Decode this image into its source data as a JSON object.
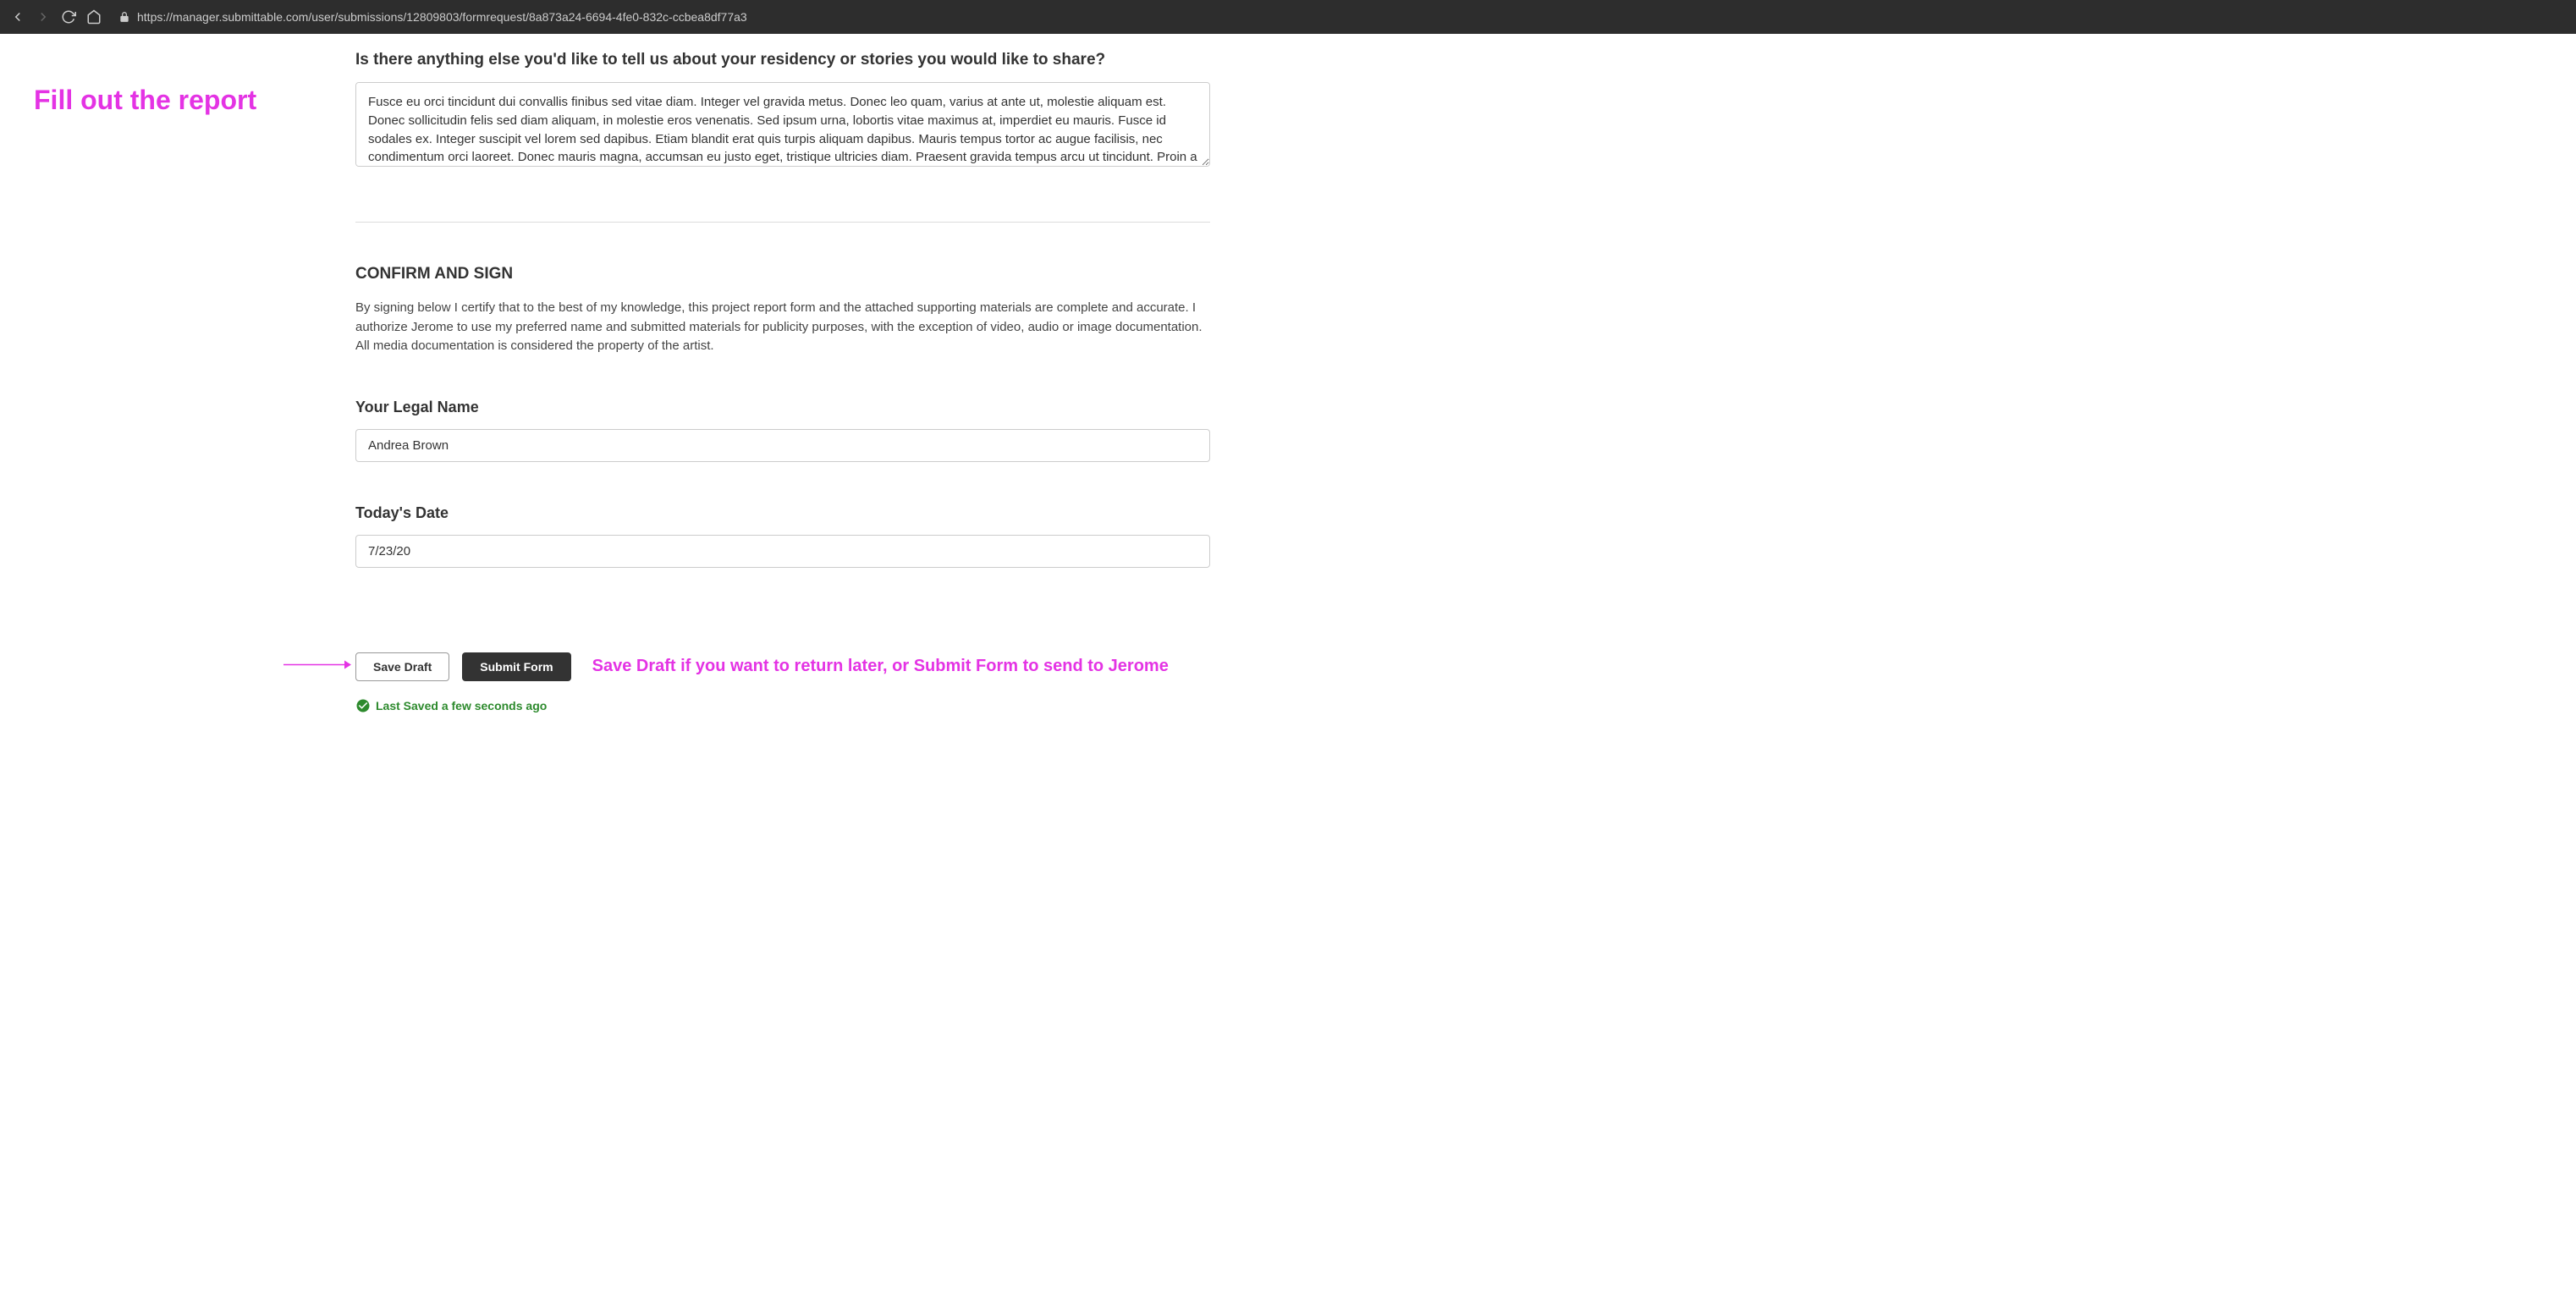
{
  "browser": {
    "url": "https://manager.submittable.com/user/submissions/12809803/formrequest/8a873a24-6694-4fe0-832c-ccbea8df77a3"
  },
  "annotations": {
    "left_title": "Fill out the report",
    "button_hint": "Save Draft if you want to return later, or Submit Form to send to Jerome"
  },
  "form": {
    "question_label": "Is there anything else you'd like to tell us about your residency or stories you would like to share?",
    "question_value": "Fusce eu orci tincidunt dui convallis finibus sed vitae diam. Integer vel gravida metus. Donec leo quam, varius at ante ut, molestie aliquam est. Donec sollicitudin felis sed diam aliquam, in molestie eros venenatis. Sed ipsum urna, lobortis vitae maximus at, imperdiet eu mauris. Fusce id sodales ex. Integer suscipit vel lorem sed dapibus. Etiam blandit erat quis turpis aliquam dapibus. Mauris tempus tortor ac augue facilisis, nec condimentum orci laoreet. Donec mauris magna, accumsan eu justo eget, tristique ultricies diam. Praesent gravida tempus arcu ut tincidunt. Proin a facilisis augue.",
    "confirm_heading": "CONFIRM AND SIGN",
    "confirm_description": "By signing below I certify that to the best of my knowledge, this project report form and the attached supporting materials are complete and accurate. I authorize Jerome to use my preferred name and submitted materials for publicity purposes, with the exception of video, audio or image documentation. All media documentation is considered the property of the artist.",
    "legal_name_label": "Your Legal Name",
    "legal_name_value": "Andrea Brown",
    "date_label": "Today's Date",
    "date_value": "7/23/20",
    "save_draft_label": "Save Draft",
    "submit_label": "Submit Form",
    "save_status": "Last Saved a few seconds ago"
  }
}
